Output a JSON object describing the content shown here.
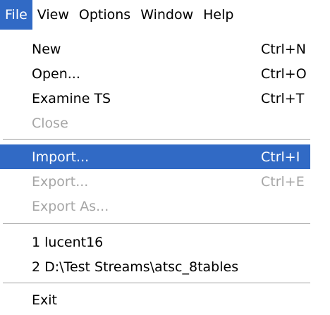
{
  "menubar": {
    "items": [
      {
        "label": "File",
        "active": true
      },
      {
        "label": "View"
      },
      {
        "label": "Options"
      },
      {
        "label": "Window"
      },
      {
        "label": "Help"
      }
    ]
  },
  "file_menu": {
    "groups": [
      [
        {
          "label": "New",
          "shortcut": "Ctrl+N"
        },
        {
          "label": "Open...",
          "shortcut": "Ctrl+O"
        },
        {
          "label": "Examine TS",
          "shortcut": "Ctrl+T"
        },
        {
          "label": "Close",
          "shortcut": "",
          "disabled": true
        }
      ],
      [
        {
          "label": "Import...",
          "shortcut": "Ctrl+I",
          "highlighted": true
        },
        {
          "label": "Export...",
          "shortcut": "Ctrl+E",
          "disabled": true
        },
        {
          "label": "Export As...",
          "shortcut": "",
          "disabled": true
        }
      ],
      [
        {
          "label": "1 lucent16",
          "shortcut": ""
        },
        {
          "label": "2 D:\\Test Streams\\atsc_8tables",
          "shortcut": ""
        }
      ],
      [
        {
          "label": "Exit",
          "shortcut": ""
        }
      ]
    ]
  },
  "colors": {
    "highlight": "#316ac5",
    "disabled_text": "#a6a6a6"
  }
}
